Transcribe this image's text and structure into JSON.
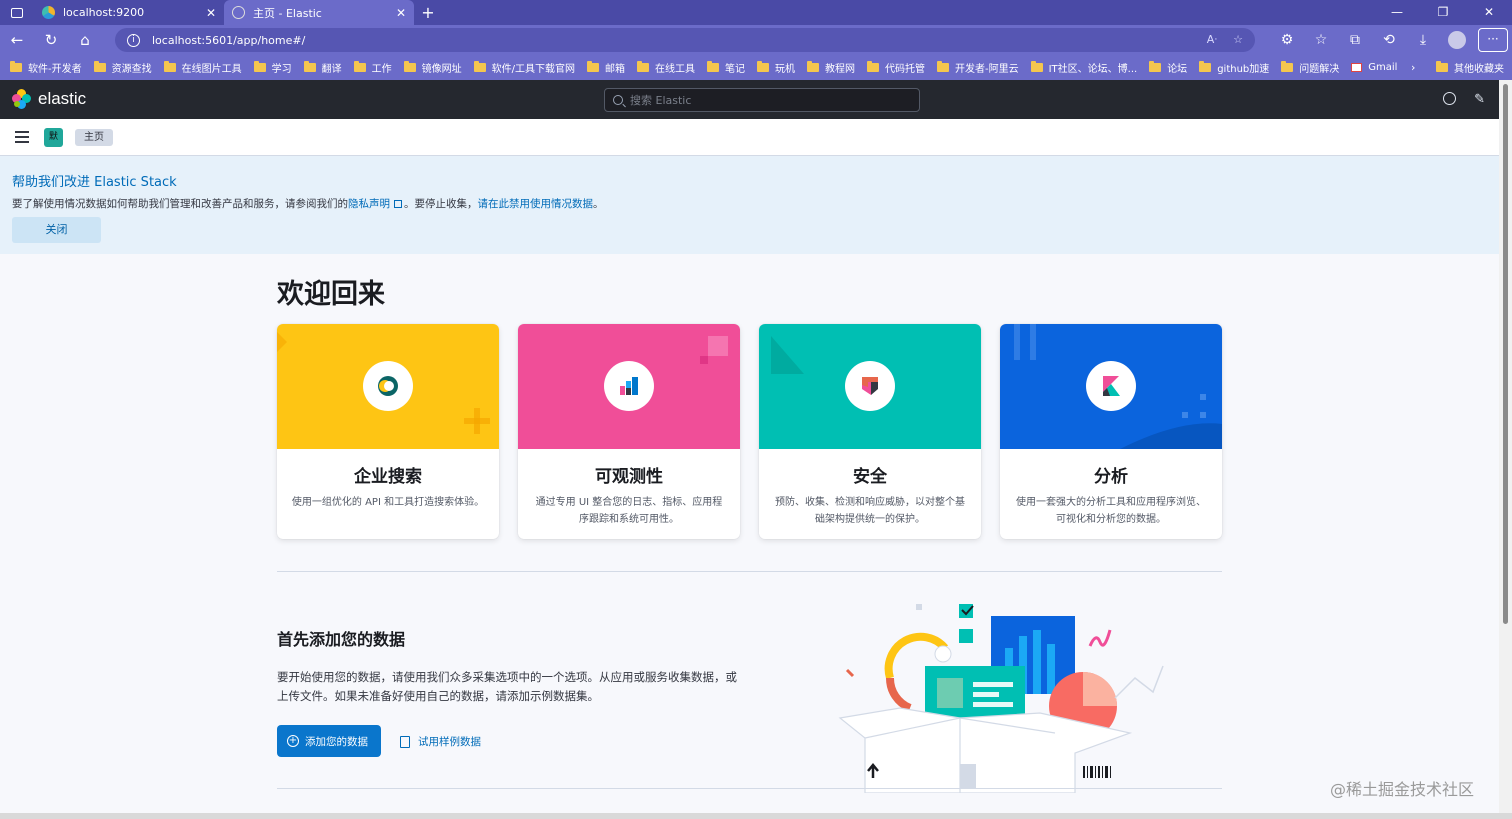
{
  "browser": {
    "tabs": [
      {
        "title": "localhost:9200",
        "active": false
      },
      {
        "title": "主页 - Elastic",
        "active": true
      }
    ],
    "url": "localhost:5601/app/home#/",
    "bookmarks": [
      {
        "label": "软件-开发者",
        "icon": "folder-icon"
      },
      {
        "label": "资源查找",
        "icon": "folder-icon"
      },
      {
        "label": "在线图片工具",
        "icon": "folder-icon"
      },
      {
        "label": "学习",
        "icon": "folder-icon"
      },
      {
        "label": "翻译",
        "icon": "folder-icon"
      },
      {
        "label": "工作",
        "icon": "folder-icon"
      },
      {
        "label": "镜像网址",
        "icon": "folder-icon"
      },
      {
        "label": "软件/工具下载官网",
        "icon": "folder-icon"
      },
      {
        "label": "邮箱",
        "icon": "folder-icon"
      },
      {
        "label": "在线工具",
        "icon": "folder-icon"
      },
      {
        "label": "笔记",
        "icon": "folder-icon"
      },
      {
        "label": "玩机",
        "icon": "folder-icon"
      },
      {
        "label": "教程网",
        "icon": "folder-icon"
      },
      {
        "label": "代码托管",
        "icon": "folder-icon"
      },
      {
        "label": "开发者-阿里云",
        "icon": "folder-icon"
      },
      {
        "label": "IT社区、论坛、博...",
        "icon": "folder-icon"
      },
      {
        "label": "论坛",
        "icon": "folder-icon"
      },
      {
        "label": "github加速",
        "icon": "folder-icon"
      },
      {
        "label": "问题解决",
        "icon": "folder-icon"
      },
      {
        "label": "Gmail",
        "icon": "gmail-icon"
      }
    ],
    "other_bookmarks": "其他收藏夹"
  },
  "kibana": {
    "logo_text": "elastic",
    "search_placeholder": "搜索 Elastic",
    "space_initial": "默",
    "breadcrumb": "主页"
  },
  "callout": {
    "title": "帮助我们改进 Elastic Stack",
    "text_before": "要了解使用情况数据如何帮助我们管理和改善产品和服务，请参阅我们的",
    "privacy_link": "隐私声明",
    "text_middle": "。要停止收集，",
    "disable_link": "请在此禁用使用情况数据",
    "text_after": "。",
    "close_label": "关闭"
  },
  "main": {
    "welcome": "欢迎回来",
    "cards": [
      {
        "title": "企业搜索",
        "desc": "使用一组优化的 API 和工具打造搜索体验。",
        "color": "#fec514"
      },
      {
        "title": "可观测性",
        "desc": "通过专用 UI 整合您的日志、指标、应用程序跟踪和系统可用性。",
        "color": "#f04e98"
      },
      {
        "title": "安全",
        "desc": "预防、收集、检测和响应威胁，以对整个基础架构提供统一的保护。",
        "color": "#00bfb3"
      },
      {
        "title": "分析",
        "desc": "使用一套强大的分析工具和应用程序浏览、可视化和分析您的数据。",
        "color": "#0b64dd"
      }
    ],
    "add_data": {
      "title": "首先添加您的数据",
      "desc": "要开始使用您的数据，请使用我们众多采集选项中的一个选项。从应用或服务收集数据，或上传文件。如果未准备好使用自己的数据，请添加示例数据集。",
      "button": "添加您的数据",
      "sample_link": "试用样例数据"
    }
  },
  "watermark": "@稀土掘金技术社区"
}
